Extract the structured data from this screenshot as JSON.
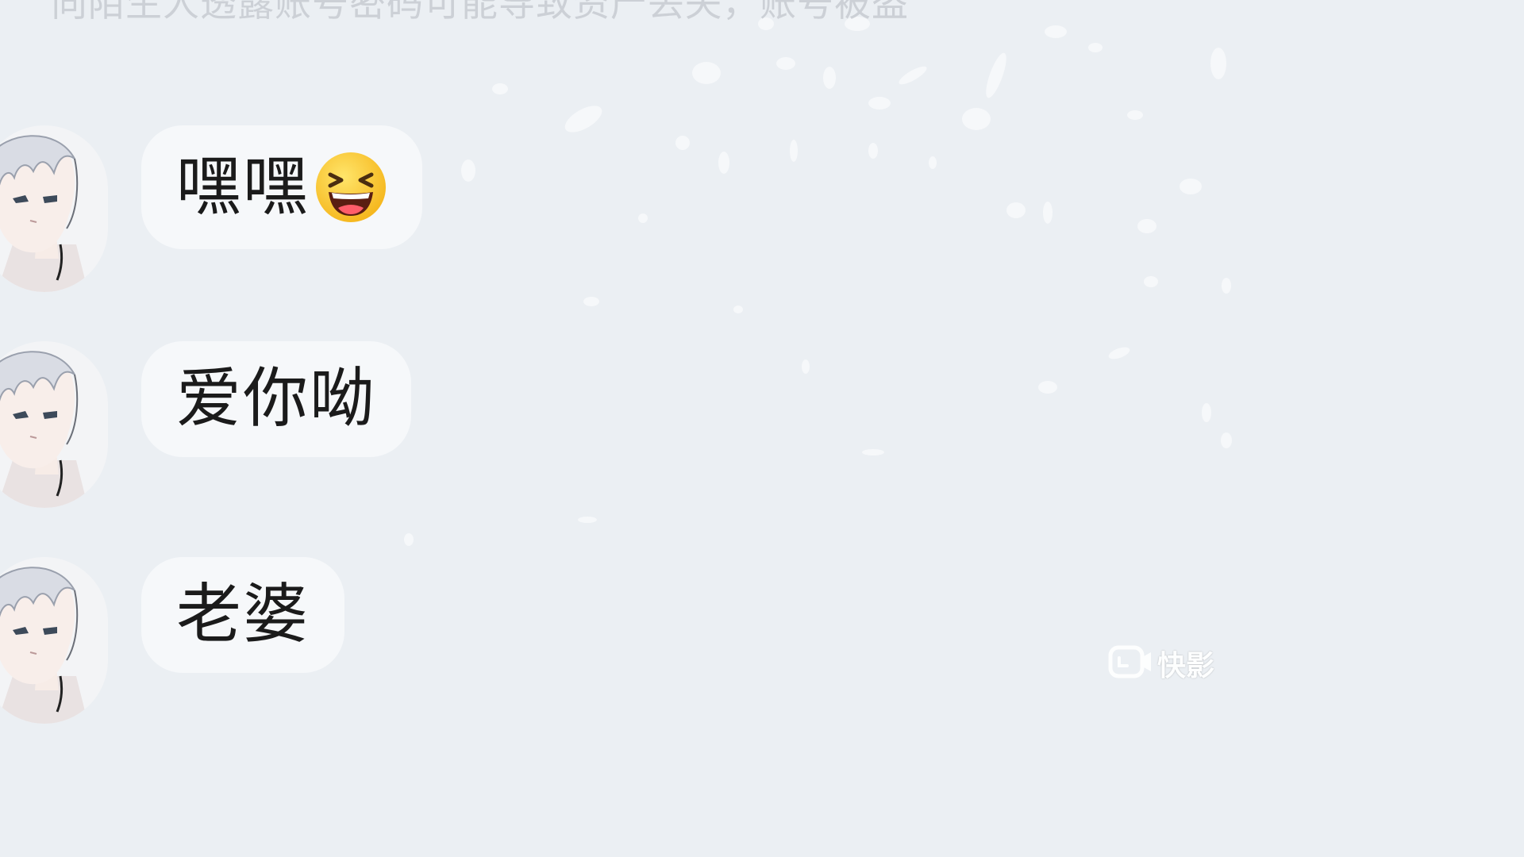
{
  "system_notice": "向陌生人透露账号密码可能导致资产丢失，账号被盗",
  "messages": [
    {
      "text": "嘿嘿",
      "emoji": "grinning-squinting-face-icon"
    },
    {
      "text": "爱你呦"
    },
    {
      "text": "老婆"
    }
  ],
  "watermark": {
    "label": "快影",
    "icon": "kuaiying-camera-icon"
  },
  "colors": {
    "background": "#ebeff3",
    "bubble": "#f6f8fa",
    "text": "#1b1b1b",
    "notice": "#c7cbd0"
  }
}
